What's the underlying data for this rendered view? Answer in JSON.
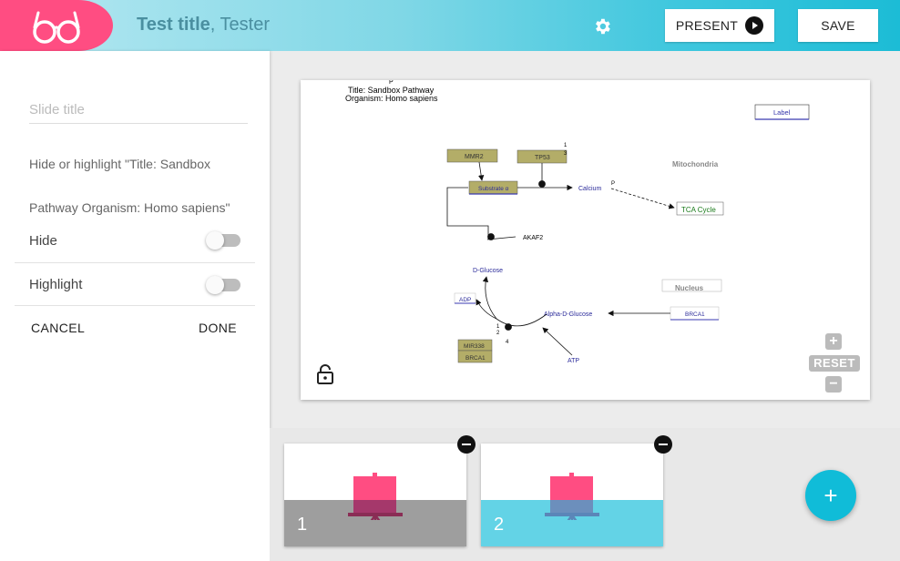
{
  "header": {
    "title_bold": "Test title",
    "title_rest": ", Tester",
    "settings_icon": "gear-icon",
    "logo_icon": "glasses-icon",
    "present_label": "PRESENT",
    "save_label": "SAVE",
    "colors": {
      "logo": "#ff4d82",
      "accent": "#1cbcd6"
    }
  },
  "editor": {
    "slide_title_placeholder": "Slide title",
    "slide_title_value": "",
    "hide_text_line1": "Hide or highlight \"Title: Sandbox",
    "hide_text_line2": "Pathway Organism: Homo sapiens\"",
    "hide_label": "Hide",
    "hide_on": false,
    "highlight_label": "Highlight",
    "highlight_on": false,
    "cancel_label": "CANCEL",
    "done_label": "DONE"
  },
  "pathway": {
    "title_line1": "Title: Sandbox Pathway",
    "title_line2": "Organism: Homo sapiens",
    "p_marker": "P",
    "nodes": {
      "label": "Label",
      "mitochondria": "Mitochondria",
      "mmr2": "MMR2",
      "tp53": "TP53",
      "substrate": "Substrate α",
      "calcium": "Calcium",
      "tca": "TCA Cycle",
      "akaf2": "AKAF2",
      "dglucose": "D-Glucose",
      "adp": "ADP",
      "alpha_glucose": "Alpha-D-Glucose",
      "nucleus": "Nucleus",
      "brca1": "BRCA1",
      "mir338": "MIR338",
      "brca1_b": "BRCA1",
      "atp": "ATP",
      "anchor_1": "1",
      "anchor_3": "3",
      "anchor_2": "2",
      "anchor_4": "4"
    },
    "zoom_in": "+",
    "reset_label": "RESET",
    "zoom_out": "−",
    "lock_icon": "unlock-icon"
  },
  "slides": [
    {
      "number": "1"
    },
    {
      "number": "2"
    }
  ],
  "add_slide_label": "+"
}
